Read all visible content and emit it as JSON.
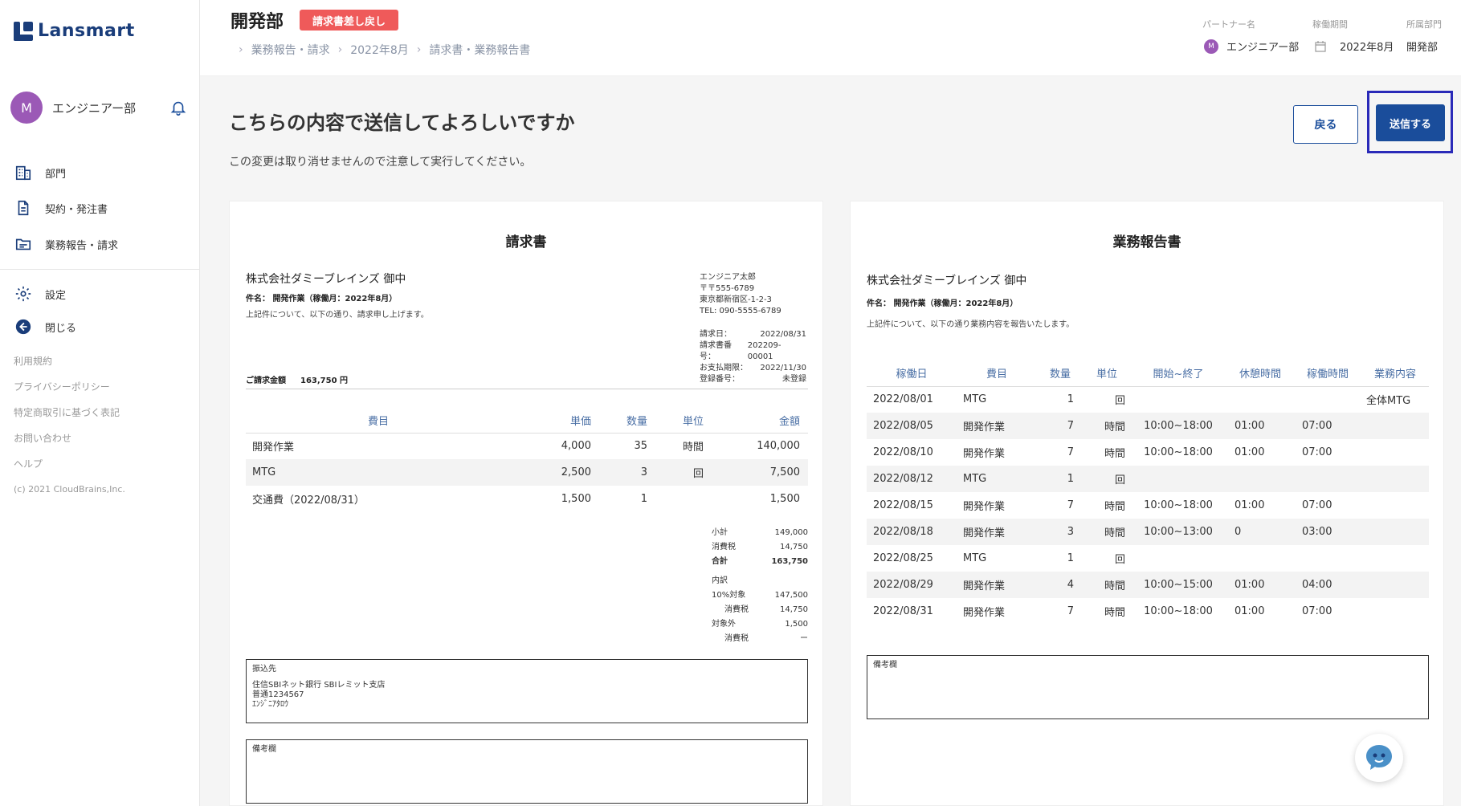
{
  "sidebar": {
    "logo_text": "Lansmart",
    "avatar_initial": "M",
    "user_name": "エンジニアー部",
    "nav": [
      {
        "label": "部門"
      },
      {
        "label": "契約・発注書"
      },
      {
        "label": "業務報告・請求"
      },
      {
        "label": "設定"
      },
      {
        "label": "閉じる"
      }
    ],
    "footer_links": [
      "利用規約",
      "プライバシーポリシー",
      "特定商取引に基づく表記",
      "お問い合わせ",
      "ヘルプ"
    ],
    "copyright": "(c) 2021 CloudBrains,Inc."
  },
  "header": {
    "title": "開発部",
    "status_badge": "請求書差し戻し",
    "breadcrumb": [
      "業務報告・請求",
      "2022年8月",
      "請求書・業務報告書"
    ],
    "partner_label": "パートナー名",
    "partner_avatar": "M",
    "partner_value": "エンジニアー部",
    "period_label": "稼働期間",
    "period_value": "2022年8月",
    "dept_label": "所属部門",
    "dept_value": "開発部"
  },
  "confirm": {
    "title": "こちらの内容で送信してよろしいですか",
    "subtitle": "この変更は取り消せませんので注意して実行してください。",
    "back_label": "戻る",
    "send_label": "送信する"
  },
  "invoice": {
    "title": "請求書",
    "to": "株式会社ダミーブレインズ 御中",
    "subject": "件名： 開発作業（稼働月：2022年8月）",
    "desc": "上記件について、以下の通り、請求申し上げます。",
    "sender": [
      "エンジニア太郎",
      "〒〒555-6789",
      "東京都新宿区-1-2-3",
      "TEL: 090-5555-6789"
    ],
    "meta": [
      {
        "k": "請求日：",
        "v": "2022/08/31"
      },
      {
        "k": "請求書番号：",
        "v": "202209-00001"
      },
      {
        "k": "お支払期限：",
        "v": "2022/11/30"
      },
      {
        "k": "登録番号：",
        "v": "未登録"
      }
    ],
    "amount_label": "ご請求金額",
    "amount_value": "163,750 円",
    "columns": [
      "費目",
      "単価",
      "数量",
      "単位",
      "金額"
    ],
    "rows": [
      [
        "開発作業",
        "4,000",
        "35",
        "時間",
        "140,000"
      ],
      [
        "MTG",
        "2,500",
        "3",
        "回",
        "7,500"
      ],
      [
        "交通費（2022/08/31）",
        "1,500",
        "1",
        "",
        "1,500"
      ]
    ],
    "totals": {
      "subtotal_label": "小計",
      "subtotal": "149,000",
      "tax_label": "消費税",
      "tax": "14,750",
      "total_label": "合計",
      "total": "163,750",
      "breakdown_label": "内訳",
      "taxed_label": "10%対象",
      "taxed": "147,500",
      "taxed_tax_label": "消費税",
      "taxed_tax": "14,750",
      "exempt_label": "対象外",
      "exempt": "1,500",
      "exempt_tax_label": "消費税",
      "exempt_tax": "ー"
    },
    "bank_label": "振込先",
    "bank_lines": [
      "住信SBIネット銀行 SBIレミット支店",
      "普通1234567",
      "ｴﾝｼﾞﾆｱﾀﾛｳ"
    ],
    "remarks_label": "備考欄"
  },
  "report": {
    "title": "業務報告書",
    "to": "株式会社ダミーブレインズ 御中",
    "subject": "件名： 開発作業（稼働月：2022年8月）",
    "desc": "上記件について、以下の通り業務内容を報告いたします。",
    "columns": [
      "稼働日",
      "費目",
      "数量",
      "単位",
      "開始~終了",
      "休憩時間",
      "稼働時間",
      "業務内容"
    ],
    "rows": [
      [
        "2022/08/01",
        "MTG",
        "1",
        "回",
        "",
        "",
        "",
        "全体MTG"
      ],
      [
        "2022/08/05",
        "開発作業",
        "7",
        "時間",
        "10:00~18:00",
        "01:00",
        "07:00",
        ""
      ],
      [
        "2022/08/10",
        "開発作業",
        "7",
        "時間",
        "10:00~18:00",
        "01:00",
        "07:00",
        ""
      ],
      [
        "2022/08/12",
        "MTG",
        "1",
        "回",
        "",
        "",
        "",
        ""
      ],
      [
        "2022/08/15",
        "開発作業",
        "7",
        "時間",
        "10:00~18:00",
        "01:00",
        "07:00",
        ""
      ],
      [
        "2022/08/18",
        "開発作業",
        "3",
        "時間",
        "10:00~13:00",
        "0",
        "03:00",
        ""
      ],
      [
        "2022/08/25",
        "MTG",
        "1",
        "回",
        "",
        "",
        "",
        ""
      ],
      [
        "2022/08/29",
        "開発作業",
        "4",
        "時間",
        "10:00~15:00",
        "01:00",
        "04:00",
        ""
      ],
      [
        "2022/08/31",
        "開発作業",
        "7",
        "時間",
        "10:00~18:00",
        "01:00",
        "07:00",
        ""
      ]
    ],
    "remarks_label": "備考欄"
  },
  "colors": {
    "brand": "#1a3d7a",
    "primary": "#1a4d9b",
    "badge": "#ef5a5a",
    "avatar": "#9b59b6",
    "focus_ring": "#2a2ab8"
  },
  "icons": {
    "nav": [
      "building-icon",
      "document-icon",
      "folder-icon",
      "gear-icon",
      "back-arrow-icon"
    ],
    "bell": "bell-icon",
    "calendar": "calendar-icon",
    "chat": "chatbot-icon"
  }
}
